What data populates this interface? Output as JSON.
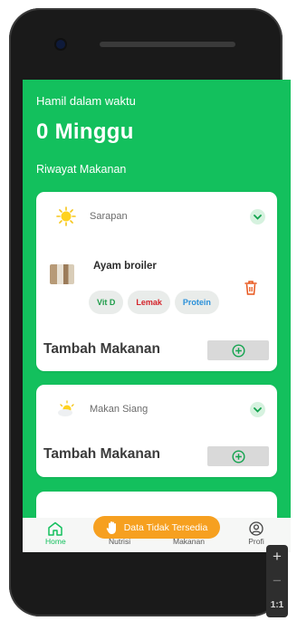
{
  "screen": {
    "pregnancy_label": "Hamil dalam waktu",
    "weeks_value": "0 Minggu",
    "history_title": "Riwayat Makanan"
  },
  "meals": [
    {
      "name": "Sarapan",
      "icon": "sun-icon",
      "food": {
        "name": "Ayam broiler",
        "tags": [
          "Vit D",
          "Lemak",
          "Protein"
        ]
      },
      "add_label": "Tambah Makanan"
    },
    {
      "name": "Makan Siang",
      "icon": "partly-cloudy-sun-icon",
      "add_label": "Tambah Makanan"
    }
  ],
  "nav": {
    "items": [
      {
        "label": "Home",
        "icon": "home-icon",
        "active": true
      },
      {
        "label": "Nutrisi"
      },
      {
        "label": "Makanan"
      },
      {
        "label": "Profi",
        "icon": "profile-icon"
      }
    ]
  },
  "toast": {
    "text": "Data Tidak Tersedia",
    "icon": "hand-icon"
  },
  "emulator": {
    "zoom_in": "+",
    "zoom_out": "−",
    "ratio": "1:1"
  },
  "colors": {
    "primary_green": "#13c05d",
    "toast_orange": "#f6a020",
    "fat_red": "#d4232a",
    "protein_blue": "#2a90d9",
    "vit_green": "#1f9d4a"
  }
}
